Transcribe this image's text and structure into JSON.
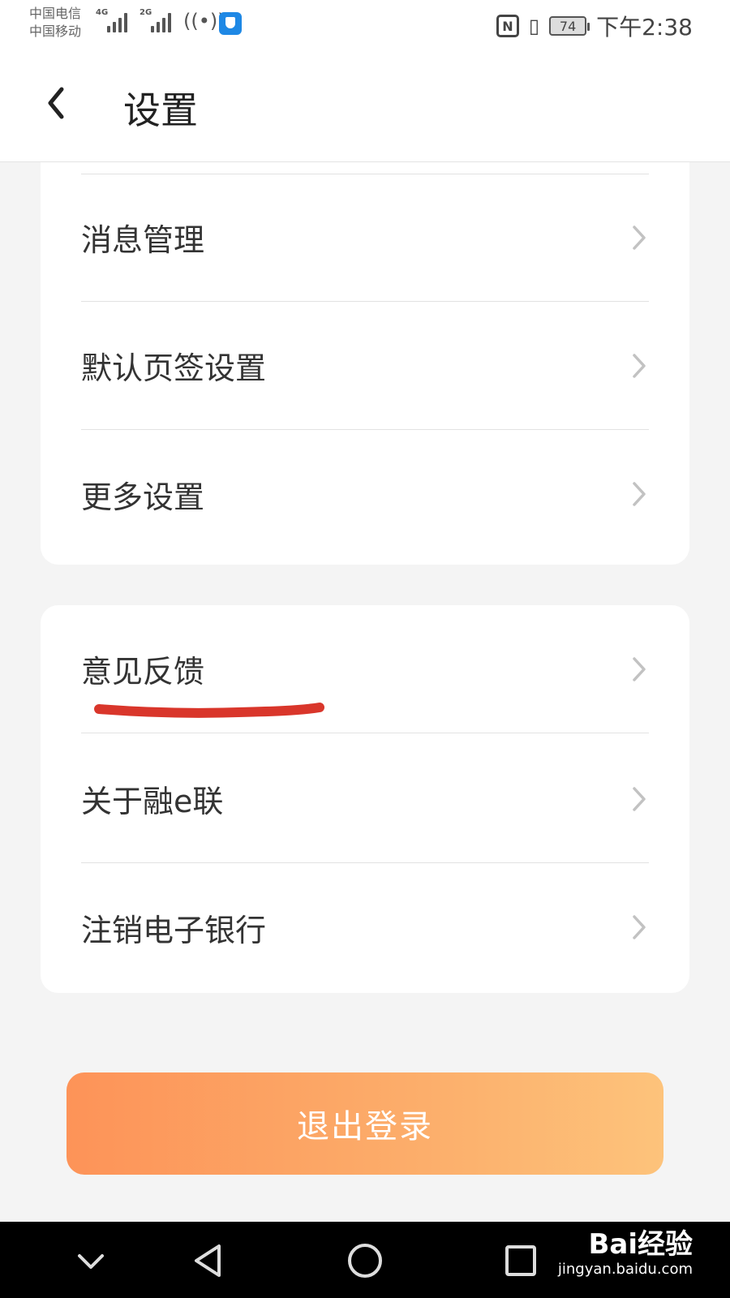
{
  "status_bar": {
    "carrier_1": "中国电信",
    "carrier_2": "中国移动",
    "sim1_network": "4G",
    "sim2_network": "2G",
    "hotspot_count": "2",
    "battery": "74",
    "time": "下午2:38"
  },
  "header": {
    "title": "设置",
    "back_icon": "chevron-left-icon"
  },
  "group1": {
    "items": [
      {
        "label": "消息管理"
      },
      {
        "label": "默认页签设置"
      },
      {
        "label": "更多设置"
      }
    ]
  },
  "group2": {
    "items": [
      {
        "label": "意见反馈"
      },
      {
        "label": "关于融e联"
      },
      {
        "label": "注销电子银行"
      }
    ]
  },
  "logout_label": "退出登录",
  "watermark": {
    "main": "Bai经验",
    "sub": "jingyan.baidu.com"
  },
  "colors": {
    "logout_gradient_start": "#fd9358",
    "logout_gradient_end": "#fdc37b",
    "annotation_red": "#d9362b",
    "background": "#f4f4f4"
  }
}
